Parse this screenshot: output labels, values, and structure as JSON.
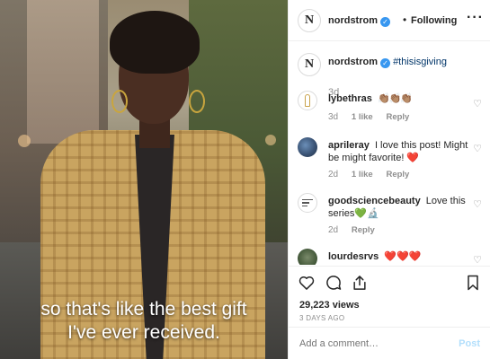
{
  "video": {
    "caption_line1": "so that's like the best gift",
    "caption_line2": "I've ever received."
  },
  "header": {
    "account_name": "nordstrom",
    "logo_letter": "N",
    "follow_status": "Following",
    "separator": "•",
    "more_icon": "more-horizontal-icon"
  },
  "post_caption": {
    "account_name": "nordstrom",
    "logo_letter": "N",
    "hashtag": "#thisisgiving",
    "time": "3d"
  },
  "comments": [
    {
      "username": "lybethras",
      "text": "👏🏽👏🏽👏🏽",
      "time": "3d",
      "likes": "1 like",
      "reply": "Reply"
    },
    {
      "username": "aprileray",
      "text": "I love this post! Might be might favorite! ❤️",
      "time": "2d",
      "likes": "1 like",
      "reply": "Reply"
    },
    {
      "username": "goodsciencebeauty",
      "text": "Love this series💚🔬",
      "time": "2d",
      "reply": "Reply"
    },
    {
      "username": "lourdesrvs",
      "text": "❤️❤️❤️"
    }
  ],
  "actions": {
    "icons": [
      "heart-icon",
      "comment-icon",
      "share-icon",
      "bookmark-icon"
    ],
    "views": "29,223 views",
    "posted_ago": "3 DAYS AGO"
  },
  "add_comment": {
    "placeholder": "Add a comment…",
    "post_label": "Post"
  },
  "colors": {
    "verified_blue": "#3897f0",
    "hashtag_blue": "#003569",
    "post_disabled": "#b2dffc",
    "muted_text": "#8e8e8e",
    "heart_red": "#ed4956"
  }
}
